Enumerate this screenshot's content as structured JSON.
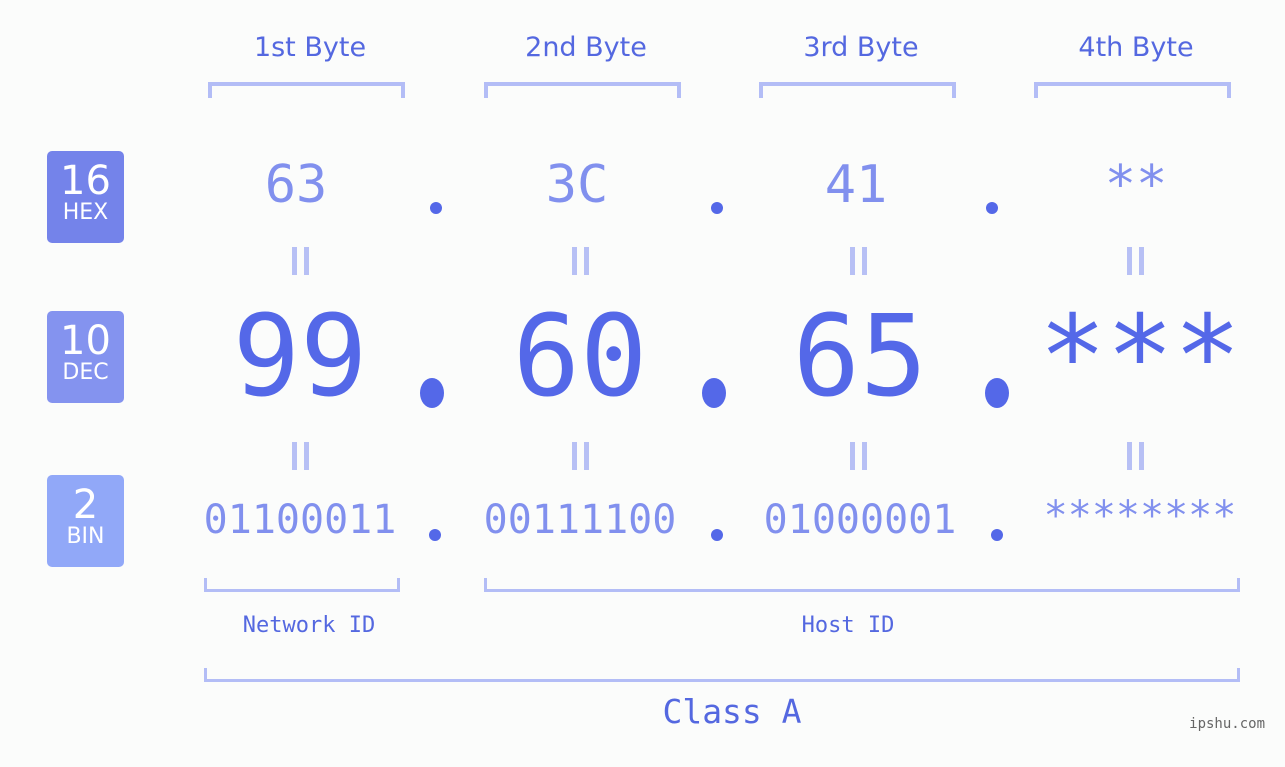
{
  "bases": [
    {
      "num": "16",
      "label": "HEX",
      "color": "#7483ea"
    },
    {
      "num": "10",
      "label": "DEC",
      "color": "#8493ef"
    },
    {
      "num": "2",
      "label": "BIN",
      "color": "#91a8f8"
    }
  ],
  "bytes": [
    {
      "label": "1st Byte",
      "hex": "63",
      "dec": "99",
      "bin": "01100011"
    },
    {
      "label": "2nd Byte",
      "hex": "3C",
      "dec": "60",
      "bin": "00111100"
    },
    {
      "label": "3rd Byte",
      "hex": "41",
      "dec": "65",
      "bin": "01000001"
    },
    {
      "label": "4th Byte",
      "hex": "**",
      "dec": "***",
      "bin": "********"
    }
  ],
  "network_label": "Network ID",
  "host_label": "Host ID",
  "class_label": "Class A",
  "watermark": "ipshu.com",
  "colors": {
    "accent": "#5468e8",
    "light": "#8190ee",
    "bracket": "#b3bdf6"
  }
}
